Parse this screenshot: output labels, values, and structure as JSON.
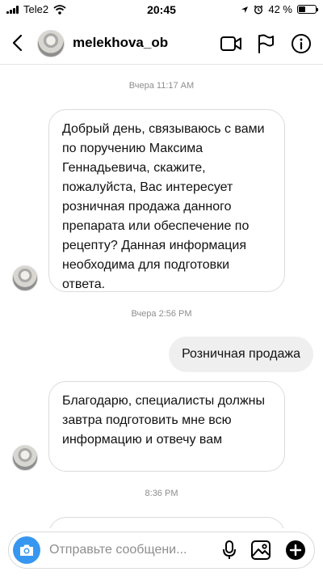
{
  "status_bar": {
    "carrier": "Tele2",
    "time": "20:45",
    "battery": "42 %",
    "battery_level": 0.42
  },
  "header": {
    "username": "melekhova_ob"
  },
  "chat": {
    "timestamp_1": "Вчера 11:17 AM",
    "message_1": "Добрый день, связываюсь с вами по поручению Максима Геннадьевича, скажите, пожалуйста, Вас интересует розничная продажа данного препарата или обеспечение по рецепту? Данная информация необходима для подготовки ответа.",
    "timestamp_2": "Вчера 2:56 PM",
    "message_2": "Розничная продажа",
    "message_3": "Благодарю, специалисты должны завтра подготовить мне всю информацию и отвечу вам",
    "timestamp_3": "8:36 PM"
  },
  "composer": {
    "placeholder": "Отправьте сообщени..."
  },
  "icons": {
    "back": "chevron-left-icon",
    "video": "video-camera-icon",
    "flag": "flag-icon",
    "info": "info-icon",
    "camera": "camera-icon",
    "mic": "microphone-icon",
    "gallery": "image-icon",
    "plus": "plus-circle-icon"
  },
  "colors": {
    "accent": "#3797f0",
    "outgoing_bubble": "#efefef",
    "timestamp": "#8e8e8e"
  }
}
